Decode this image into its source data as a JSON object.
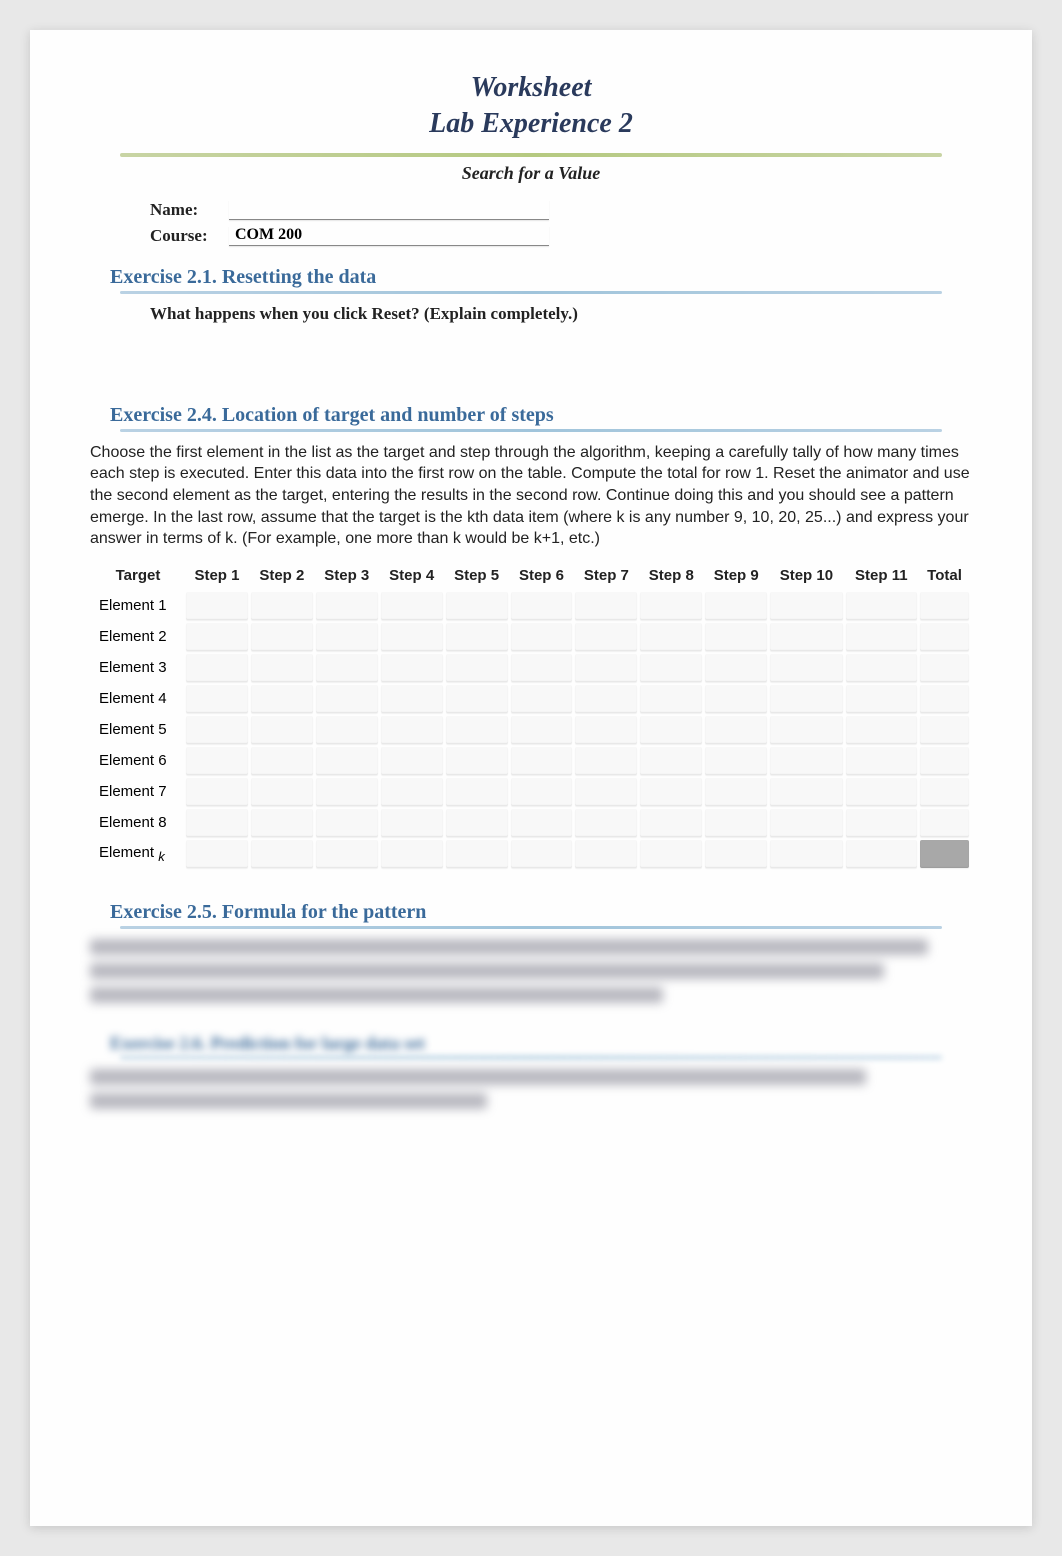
{
  "header": {
    "title_line1": "Worksheet",
    "title_line2": "Lab Experience 2",
    "subtitle": "Search for a Value",
    "name_label": "Name:",
    "name_value": "",
    "course_label": "Course:",
    "course_value": "COM 200"
  },
  "exercise21": {
    "heading": "Exercise 2.1. Resetting the data",
    "question": "What happens when you click Reset? (Explain completely.)"
  },
  "exercise24": {
    "heading": "Exercise 2.4. Location of target and number of steps",
    "body": "Choose the first element in the list as the target and step through the algorithm, keeping a carefully tally of how many times each step is executed. Enter this data into the first row on the table. Compute the total for row 1. Reset the animator and use the second element as the target, entering the results in the second row. Continue doing this and you should see a pattern emerge. In the last row, assume that the target is the kth data item (where k is any number 9, 10, 20, 25...) and express your answer in terms of k. (For example, one more than k would be k+1, etc.)",
    "table": {
      "columns": [
        "Target",
        "Step 1",
        "Step 2",
        "Step 3",
        "Step 4",
        "Step 5",
        "Step 6",
        "Step 7",
        "Step 8",
        "Step 9",
        "Step 10",
        "Step 11",
        "Total"
      ],
      "rows": [
        "Element 1",
        "Element 2",
        "Element 3",
        "Element 4",
        "Element 5",
        "Element 6",
        "Element 7",
        "Element 8"
      ],
      "last_row_prefix": "Element ",
      "last_row_suffix": "k"
    }
  },
  "exercise25": {
    "heading": "Exercise 2.5. Formula for the pattern"
  }
}
